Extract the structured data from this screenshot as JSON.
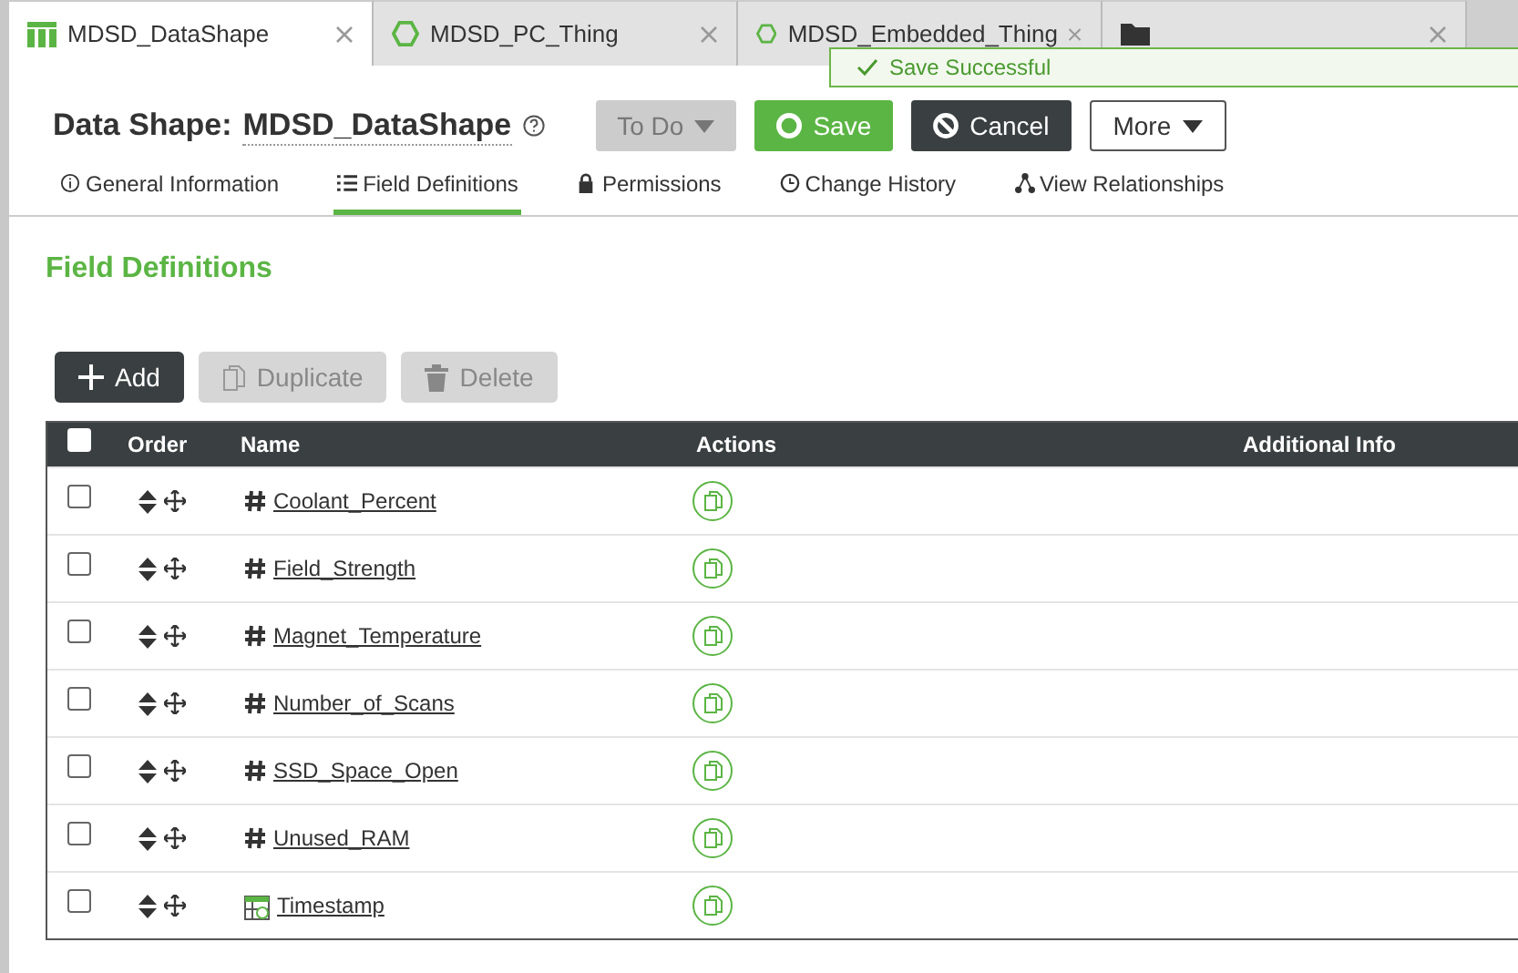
{
  "tabs": [
    {
      "label": "MDSD_DataShape",
      "kind": "datashape",
      "selected": true
    },
    {
      "label": "MDSD_PC_Thing",
      "kind": "thing",
      "selected": false
    },
    {
      "label": "MDSD_Embedded_Thing",
      "kind": "thing",
      "selected": false
    },
    {
      "kind": "folder",
      "selected": false
    }
  ],
  "toast": {
    "message": "Save Successful"
  },
  "header": {
    "type": "Data Shape:",
    "name": "MDSD_DataShape"
  },
  "actions": [
    {
      "label": "To Do",
      "kind": "todo",
      "disabled": true
    },
    {
      "label": "Save",
      "kind": "save",
      "disabled": false
    },
    {
      "label": "Cancel",
      "kind": "cancel",
      "disabled": false
    },
    {
      "label": "More",
      "kind": "more",
      "disabled": false
    }
  ],
  "subtabs": [
    {
      "label": "General Information",
      "kind": "info",
      "selected": false
    },
    {
      "label": "Field Definitions",
      "kind": "list",
      "selected": true
    },
    {
      "label": "Permissions",
      "kind": "lock",
      "selected": false
    },
    {
      "label": "Change History",
      "kind": "clock",
      "selected": false
    },
    {
      "label": "View Relationships",
      "kind": "graph",
      "selected": false
    }
  ],
  "section_title": "Field Definitions",
  "toolbar": [
    {
      "label": "Add",
      "kind": "add",
      "disabled": false
    },
    {
      "label": "Duplicate",
      "kind": "duplicate",
      "disabled": true
    },
    {
      "label": "Delete",
      "kind": "delete",
      "disabled": true
    }
  ],
  "table": {
    "all_checked": false,
    "columns": [
      "Order",
      "Name",
      "Actions",
      "Additional Info"
    ],
    "rows": [
      {
        "name": "Coolant_Percent",
        "kind": "number",
        "checked": false
      },
      {
        "name": "Field_Strength",
        "kind": "number",
        "checked": false
      },
      {
        "name": "Magnet_Temperature",
        "kind": "number",
        "checked": false
      },
      {
        "name": "Number_of_Scans",
        "kind": "number",
        "checked": false
      },
      {
        "name": "SSD_Space_Open",
        "kind": "number",
        "checked": false
      },
      {
        "name": "Unused_RAM",
        "kind": "number",
        "checked": false
      },
      {
        "name": "Timestamp",
        "kind": "datetime",
        "checked": false
      }
    ]
  }
}
